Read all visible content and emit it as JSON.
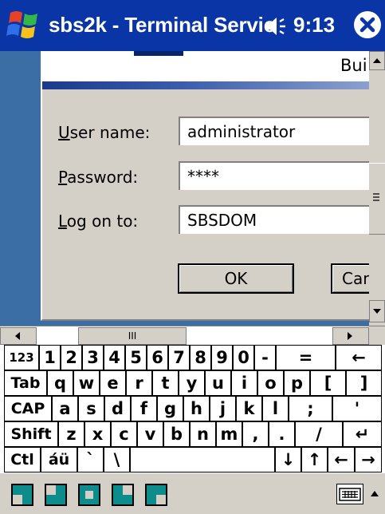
{
  "titlebar": {
    "title": "sbs2k - Terminal Servic",
    "time": "9:13",
    "icons": {
      "start": "windows-flag-icon",
      "volume": "speaker-icon",
      "close": "close-icon"
    }
  },
  "dialog": {
    "partial_title": "Bui",
    "username_label": "User name:",
    "username_value": "administrator",
    "password_label": "Password:",
    "password_value": "****",
    "logon_label": "Log on to:",
    "logon_value": "SBSDOM",
    "ok_label": "OK",
    "cancel_label": "Can"
  },
  "hscroll": {
    "thumb_glyph": "III"
  },
  "keyboard": {
    "rows": [
      [
        "123",
        "1",
        "2",
        "3",
        "4",
        "5",
        "6",
        "7",
        "8",
        "9",
        "0",
        "-",
        "=",
        "←"
      ],
      [
        "Tab",
        "q",
        "w",
        "e",
        "r",
        "t",
        "y",
        "u",
        "i",
        "o",
        "p",
        "[",
        "]"
      ],
      [
        "CAP",
        "a",
        "s",
        "d",
        "f",
        "g",
        "h",
        "j",
        "k",
        "l",
        ";",
        "'"
      ],
      [
        "Shift",
        "z",
        "x",
        "c",
        "v",
        "b",
        "n",
        "m",
        ",",
        ".",
        "/",
        "↵"
      ],
      [
        "Ctl",
        "áü",
        "`",
        "\\",
        "",
        "↓",
        "↑",
        "←",
        "→"
      ]
    ]
  },
  "colors": {
    "titlebar": "#0a35a6",
    "desktop": "#3a6ea5",
    "dialog": "#d4d0c8",
    "taskbar_icon": "#0e8c8c"
  }
}
